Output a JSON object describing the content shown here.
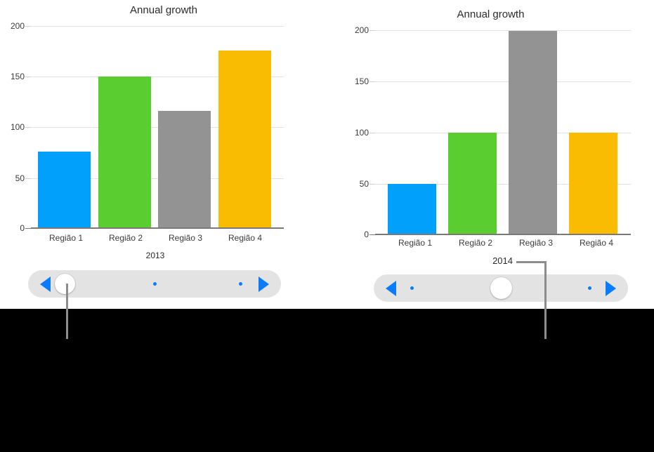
{
  "theme": {
    "panel_bg": "#ffffff",
    "backdrop": "#000000",
    "accent_blue": "#0a7bfb",
    "grid": "#e3e3e3",
    "axis": "#7d7878",
    "callout": "#8c8c8c",
    "text": "#2b2b2b"
  },
  "charts": [
    {
      "id": "chart-2013",
      "title": "Annual growth",
      "series_label": "2013",
      "y_ticks": [
        "200",
        "150",
        "100",
        "50",
        "0"
      ],
      "categories": [
        "Região 1",
        "Região 2",
        "Região 3",
        "Região 4"
      ],
      "bar_colors": [
        "#01a0fa",
        "#5ace31",
        "#939393",
        "#f9bc03"
      ]
    },
    {
      "id": "chart-2014",
      "title": "Annual growth",
      "series_label": "2014",
      "y_ticks": [
        "200",
        "150",
        "100",
        "50",
        "0"
      ],
      "categories": [
        "Região 1",
        "Região 2",
        "Região 3",
        "Região 4"
      ],
      "bar_colors": [
        "#01a0fa",
        "#5ace31",
        "#939393",
        "#f9bc03"
      ]
    }
  ],
  "sliders": [
    {
      "id": "slider-2013",
      "thumb_position_percent": 14,
      "dots_percent": [
        50,
        84
      ],
      "prev_icon": "triangle-left-icon",
      "next_icon": "triangle-right-icon"
    },
    {
      "id": "slider-2014",
      "thumb_position_percent": 50,
      "dots_percent": [
        15,
        85
      ],
      "prev_icon": "triangle-left-icon",
      "next_icon": "triangle-right-icon"
    }
  ],
  "callouts": [
    {
      "id": "callout-left",
      "label": ""
    },
    {
      "id": "callout-right",
      "label": "2014"
    }
  ],
  "chart_data": [
    {
      "type": "bar",
      "title": "Annual growth",
      "xlabel": "2013",
      "ylabel": "",
      "categories": [
        "Região 1",
        "Região 2",
        "Região 3",
        "Região 4"
      ],
      "values": [
        76,
        150,
        116,
        176
      ],
      "colors": [
        "#01a0fa",
        "#5ace31",
        "#939393",
        "#f9bc03"
      ],
      "ylim": [
        0,
        200
      ],
      "yticks": [
        0,
        50,
        100,
        150,
        200
      ],
      "grid": true,
      "legend": "none"
    },
    {
      "type": "bar",
      "title": "Annual growth",
      "xlabel": "2014",
      "ylabel": "",
      "categories": [
        "Região 1",
        "Região 2",
        "Região 3",
        "Região 4"
      ],
      "values": [
        50,
        100,
        200,
        100
      ],
      "colors": [
        "#01a0fa",
        "#5ace31",
        "#939393",
        "#f9bc03"
      ],
      "ylim": [
        0,
        200
      ],
      "yticks": [
        0,
        50,
        100,
        150,
        200
      ],
      "grid": true,
      "legend": "none"
    }
  ]
}
